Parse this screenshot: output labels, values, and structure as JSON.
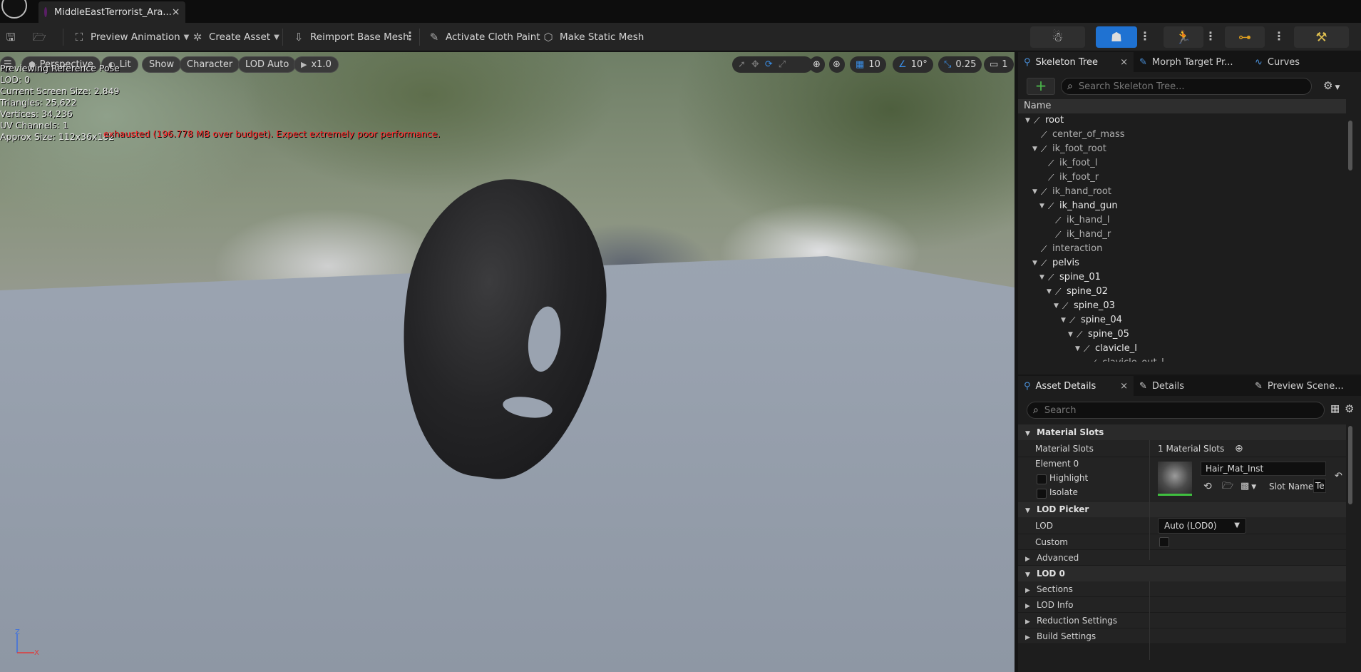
{
  "document_tab": {
    "title": "MiddleEastTerrorist_Ara...",
    "close": "×"
  },
  "toolbar": {
    "preview_animation": "Preview Animation",
    "create_asset": "Create Asset",
    "reimport_base_mesh": "Reimport Base Mesh",
    "activate_cloth_paint": "Activate Cloth Paint",
    "make_static_mesh": "Make Static Mesh"
  },
  "viewport": {
    "perspective": "Perspective",
    "lit": "Lit",
    "show": "Show",
    "character": "Character",
    "lod": "LOD Auto",
    "play_rate": "x1.0",
    "grid_snap": "10",
    "rotation_snap": "10°",
    "scale_snap": "0.25",
    "camera_speed": "1",
    "stats": [
      "Previewing Reference Pose",
      "LOD: 0",
      "Current Screen Size: 2.849",
      "Triangles: 25,622",
      "Vertices: 34,236",
      "UV Channels: 1",
      "Approx Size: 112x36x182"
    ],
    "warning": "exhausted (196.778 MB over budget). Expect extremely poor performance.",
    "axis_z": "Z",
    "axis_x": "X"
  },
  "skeleton_panel": {
    "tabs": [
      "Skeleton Tree",
      "Morph Target Pr...",
      "Curves"
    ],
    "close": "×",
    "add": "+",
    "search_placeholder": "Search Skeleton Tree...",
    "column_name": "Name",
    "bones": [
      {
        "name": "root",
        "depth": 0
      },
      {
        "name": "center_of_mass",
        "depth": 1
      },
      {
        "name": "ik_foot_root",
        "depth": 1
      },
      {
        "name": "ik_foot_l",
        "depth": 2
      },
      {
        "name": "ik_foot_r",
        "depth": 2
      },
      {
        "name": "ik_hand_root",
        "depth": 1
      },
      {
        "name": "ik_hand_gun",
        "depth": 2
      },
      {
        "name": "ik_hand_l",
        "depth": 3
      },
      {
        "name": "ik_hand_r",
        "depth": 3
      },
      {
        "name": "interaction",
        "depth": 1
      },
      {
        "name": "pelvis",
        "depth": 1
      },
      {
        "name": "spine_01",
        "depth": 2
      },
      {
        "name": "spine_02",
        "depth": 3
      },
      {
        "name": "spine_03",
        "depth": 4
      },
      {
        "name": "spine_04",
        "depth": 5
      },
      {
        "name": "spine_05",
        "depth": 6
      },
      {
        "name": "clavicle_l",
        "depth": 7
      },
      {
        "name": "clavicle_out_l",
        "depth": 8
      }
    ]
  },
  "details_panel": {
    "tabs": [
      "Asset Details",
      "Details",
      "Preview Scene..."
    ],
    "close": "×",
    "search_placeholder": "Search",
    "material_slots_header": "Material Slots",
    "material_slots_label": "Material Slots",
    "material_slots_value": "1 Material Slots",
    "element_label": "Element 0",
    "highlight": "Highlight",
    "isolate": "Isolate",
    "material_name": "Hair_Mat_Inst",
    "slot_name_label": "Slot Name",
    "slot_name_value": "Te",
    "lod_picker_header": "LOD Picker",
    "lod_label": "LOD",
    "lod_value": "Auto (LOD0)",
    "custom_label": "Custom",
    "advanced": "Advanced",
    "lod0_header": "LOD 0",
    "sections": "Sections",
    "lod_info": "LOD Info",
    "reduction_settings": "Reduction Settings",
    "build_settings": "Build Settings"
  }
}
